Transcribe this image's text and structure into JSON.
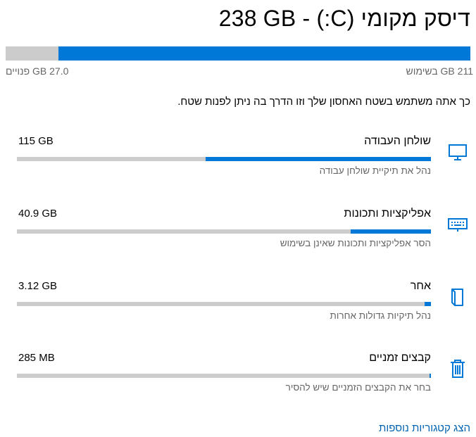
{
  "header": {
    "title": "דיסק מקומי (C:) - 238 GB"
  },
  "disk": {
    "used_label": "211 GB בשימוש",
    "free_label": "27.0 GB פנויים",
    "used_fraction": 0.886
  },
  "description": "כך אתה משתמש בשטח האחסון שלך וזו הדרך בה ניתן לפנות שטח.",
  "categories": [
    {
      "name": "שולחן העבודה",
      "size": "115 GB",
      "subtitle": "נהל את תיקיית שולחן עבודה",
      "fill_fraction": 0.545,
      "icon": "desktop-icon"
    },
    {
      "name": "אפליקציות ותכונות",
      "size": "40.9 GB",
      "subtitle": "הסר אפליקציות ותכונות שאינן בשימוש",
      "fill_fraction": 0.194,
      "icon": "keyboard-icon"
    },
    {
      "name": "אחר",
      "size": "3.12 GB",
      "subtitle": "נהל תיקיות גדולות אחרות",
      "fill_fraction": 0.015,
      "icon": "folder-icon"
    },
    {
      "name": "קבצים זמניים",
      "size": "285 MB",
      "subtitle": "בחר את הקבצים הזמניים שיש להסיר",
      "fill_fraction": 0.0014,
      "icon": "trash-icon"
    }
  ],
  "more_link": "הצג קטגוריות נוספות",
  "colors": {
    "accent": "#0078d7",
    "track": "#cccccc",
    "link": "#0063b1",
    "secondary_text": "#666666"
  }
}
